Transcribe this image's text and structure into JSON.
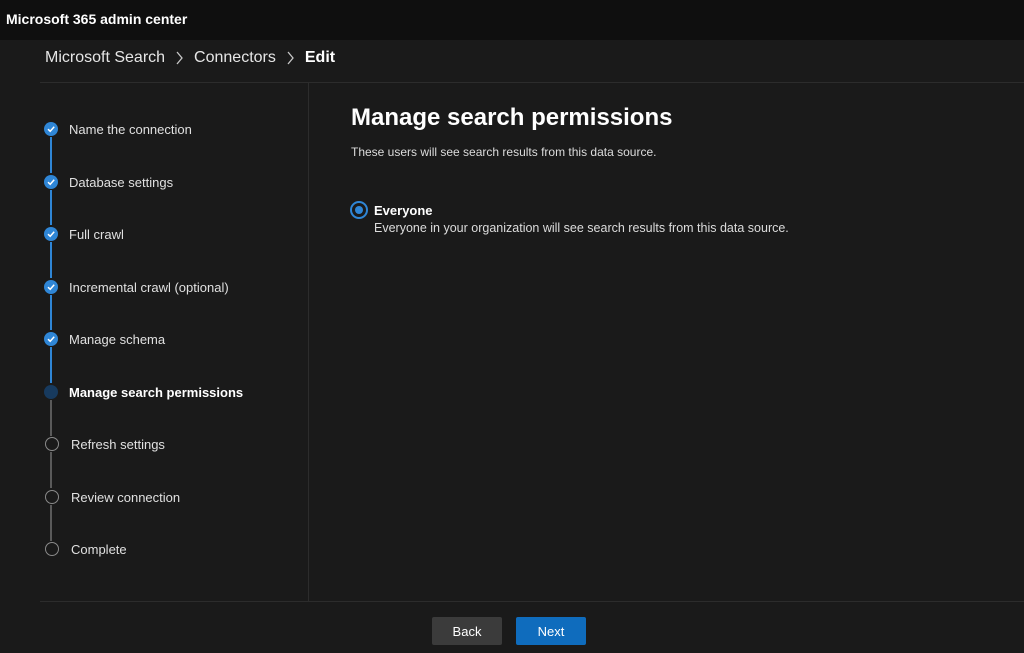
{
  "app": {
    "title": "Microsoft 365 admin center"
  },
  "breadcrumb": {
    "items": [
      "Microsoft Search",
      "Connectors"
    ],
    "current": "Edit"
  },
  "steps": [
    {
      "label": "Name the connection",
      "state": "done"
    },
    {
      "label": "Database settings",
      "state": "done"
    },
    {
      "label": "Full crawl",
      "state": "done"
    },
    {
      "label": "Incremental crawl (optional)",
      "state": "done"
    },
    {
      "label": "Manage schema",
      "state": "done"
    },
    {
      "label": "Manage search permissions",
      "state": "current"
    },
    {
      "label": "Refresh settings",
      "state": "todo"
    },
    {
      "label": "Review connection",
      "state": "todo"
    },
    {
      "label": "Complete",
      "state": "todo"
    }
  ],
  "main": {
    "title": "Manage search permissions",
    "description": "These users will see search results from this data source.",
    "option": {
      "label": "Everyone",
      "description": "Everyone in your organization will see search results from this data source.",
      "selected": true
    }
  },
  "footer": {
    "back_label": "Back",
    "next_label": "Next"
  },
  "colors": {
    "accent": "#2f86d6",
    "primary_button": "#0f6cbd",
    "background": "#1a1a1a"
  }
}
